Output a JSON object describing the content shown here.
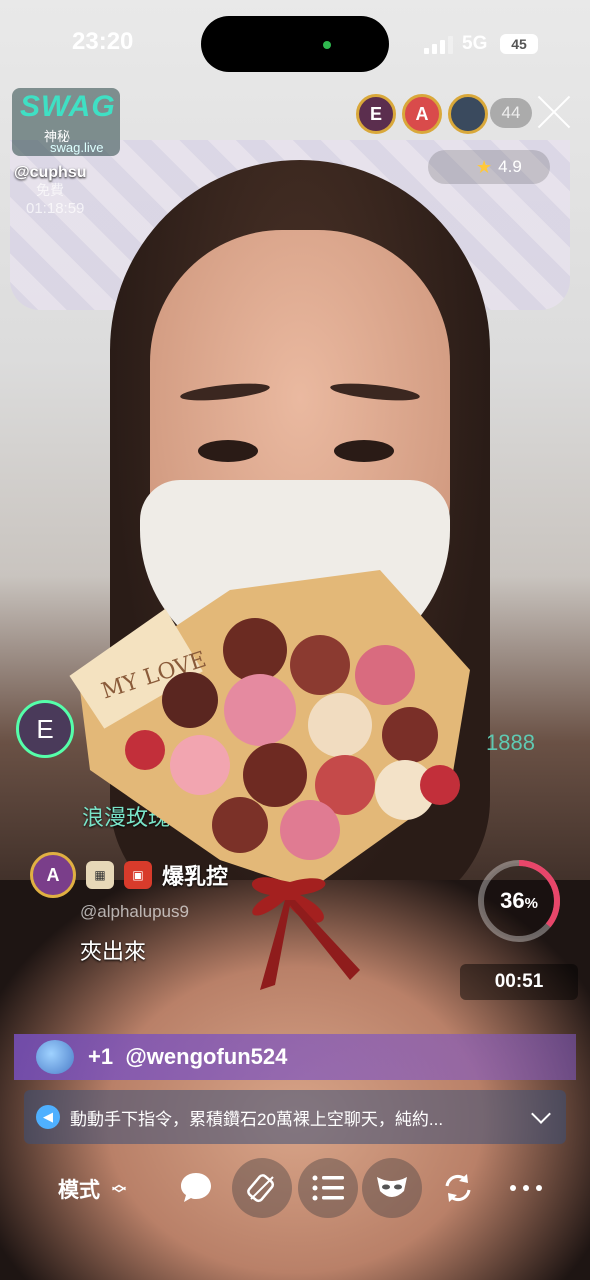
{
  "status_bar": {
    "time": "23:20",
    "network": "5G",
    "battery": "45"
  },
  "brand": {
    "logo_text": "SWAG",
    "logo_cn": "神秘",
    "site": "swag.live"
  },
  "streamer": {
    "handle": "@cuphsu",
    "label": "免費",
    "duration": "01:18:59"
  },
  "top_viewers": [
    {
      "initial": "E",
      "color": "#5b2e4e"
    },
    {
      "initial": "A",
      "color": "#d94b4b"
    },
    {
      "initial": "",
      "color": "#3a4a5e"
    }
  ],
  "viewer_count": "44",
  "rating": "4.9",
  "chat": {
    "avatar_initial": "E",
    "score": "1888",
    "message1": "浪漫玫瑰",
    "user2_badge": "A",
    "user2_badge_label": "MVP",
    "user2_name": "爆乳控",
    "user2_handle": "@alphalupus9",
    "message2": "夾出來"
  },
  "gift_card_text": "MY LOVE",
  "progress": {
    "percent": "36",
    "percent_sign": "%",
    "timer": "00:51"
  },
  "join_banner": {
    "count": "+1",
    "user": "@wengofun524"
  },
  "announcement": "動動手下指令，累積鑽石20萬裸上空聊天，純約...",
  "toolbar": {
    "mode_label": "模式"
  },
  "icons": [
    "speaker-icon",
    "chat-icon",
    "gift-icon",
    "list-icon",
    "mask-icon",
    "refresh-icon",
    "more-icon",
    "close-icon",
    "star-icon"
  ]
}
